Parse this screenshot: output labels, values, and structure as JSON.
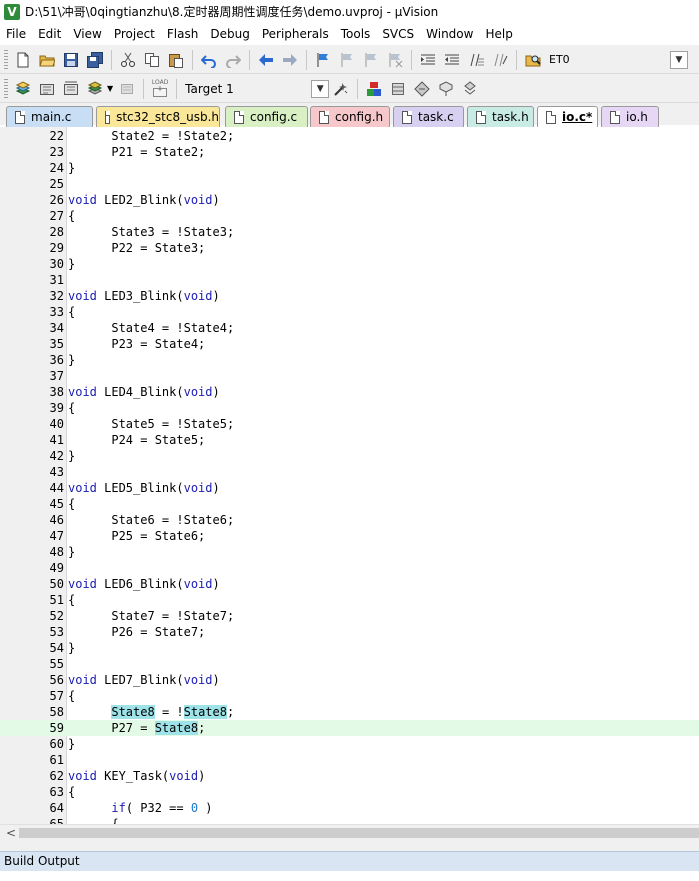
{
  "window": {
    "title": "D:\\51\\冲哥\\0qingtianzhu\\8.定时器周期性调度任务\\demo.uvproj - µVision",
    "logo_letter": "V"
  },
  "menu": [
    "File",
    "Edit",
    "View",
    "Project",
    "Flash",
    "Debug",
    "Peripherals",
    "Tools",
    "SVCS",
    "Window",
    "Help"
  ],
  "toolbar1": {
    "icons": [
      "new-file-icon",
      "open-folder-icon",
      "save-icon",
      "save-all-icon",
      "cut-icon",
      "copy-icon",
      "paste-icon",
      "undo-icon",
      "redo-icon",
      "back-icon",
      "forward-icon",
      "bookmark-icon",
      "bookmark-prev-icon",
      "bookmark-next-icon",
      "bookmark-clear-icon",
      "indent-icon",
      "unindent-icon",
      "comment-icon",
      "uncomment-icon",
      "find-in-files-icon"
    ],
    "find_value": "ET0"
  },
  "toolbar2": {
    "icons": [
      "translate-icon",
      "build-icon",
      "rebuild-icon",
      "batch-build-icon",
      "stop-build-icon",
      "download-icon"
    ],
    "load_label": "LOAD",
    "target_label": "Target 1",
    "right_icons": [
      "target-options-icon",
      "manage-components-icon",
      "select-packs-icon",
      "books-icon",
      "functions-icon",
      "templates-icon"
    ]
  },
  "tabs": [
    {
      "label": "main.c",
      "color": "#c8def4",
      "active": false
    },
    {
      "label": "stc32_stc8_usb.h",
      "color": "#fbe79a",
      "active": false
    },
    {
      "label": "config.c",
      "color": "#d8f0c4",
      "active": false
    },
    {
      "label": "config.h",
      "color": "#f6c8cc",
      "active": false
    },
    {
      "label": "task.c",
      "color": "#d8d0f0",
      "active": false
    },
    {
      "label": "task.h",
      "color": "#c8ece4",
      "active": false
    },
    {
      "label": "io.c*",
      "color": "#ffffff",
      "active": true
    },
    {
      "label": "io.h",
      "color": "#e6d8f4",
      "active": false
    }
  ],
  "code": [
    {
      "n": "22",
      "segs": [
        [
          "      State2 = !State2;",
          ""
        ]
      ]
    },
    {
      "n": "23",
      "segs": [
        [
          "      P21 = State2;",
          ""
        ]
      ]
    },
    {
      "n": "24",
      "segs": [
        [
          "}",
          ""
        ]
      ]
    },
    {
      "n": "25",
      "segs": []
    },
    {
      "n": "26",
      "segs": [
        [
          "void",
          "kw"
        ],
        [
          " LED2_Blink(",
          ""
        ],
        [
          "void",
          "kw"
        ],
        [
          ")",
          ""
        ]
      ]
    },
    {
      "n": "27",
      "segs": [
        [
          "{",
          ""
        ]
      ]
    },
    {
      "n": "28",
      "segs": [
        [
          "      State3 = !State3;",
          ""
        ]
      ]
    },
    {
      "n": "29",
      "segs": [
        [
          "      P22 = State3;",
          ""
        ]
      ]
    },
    {
      "n": "30",
      "segs": [
        [
          "}",
          ""
        ]
      ]
    },
    {
      "n": "31",
      "segs": []
    },
    {
      "n": "32",
      "segs": [
        [
          "void",
          "kw"
        ],
        [
          " LED3_Blink(",
          ""
        ],
        [
          "void",
          "kw"
        ],
        [
          ")",
          ""
        ]
      ]
    },
    {
      "n": "33",
      "segs": [
        [
          "{",
          ""
        ]
      ]
    },
    {
      "n": "34",
      "segs": [
        [
          "      State4 = !State4;",
          ""
        ]
      ]
    },
    {
      "n": "35",
      "segs": [
        [
          "      P23 = State4;",
          ""
        ]
      ]
    },
    {
      "n": "36",
      "segs": [
        [
          "}",
          ""
        ]
      ]
    },
    {
      "n": "37",
      "segs": []
    },
    {
      "n": "38",
      "segs": [
        [
          "void",
          "kw"
        ],
        [
          " LED4_Blink(",
          ""
        ],
        [
          "void",
          "kw"
        ],
        [
          ")",
          ""
        ]
      ]
    },
    {
      "n": "39",
      "segs": [
        [
          "{",
          ""
        ]
      ]
    },
    {
      "n": "40",
      "segs": [
        [
          "      State5 = !State5;",
          ""
        ]
      ]
    },
    {
      "n": "41",
      "segs": [
        [
          "      P24 = State5;",
          ""
        ]
      ]
    },
    {
      "n": "42",
      "segs": [
        [
          "}",
          ""
        ]
      ]
    },
    {
      "n": "43",
      "segs": []
    },
    {
      "n": "44",
      "segs": [
        [
          "void",
          "kw"
        ],
        [
          " LED5_Blink(",
          ""
        ],
        [
          "void",
          "kw"
        ],
        [
          ")",
          ""
        ]
      ]
    },
    {
      "n": "45",
      "segs": [
        [
          "{",
          ""
        ]
      ]
    },
    {
      "n": "46",
      "segs": [
        [
          "      State6 = !State6;",
          ""
        ]
      ]
    },
    {
      "n": "47",
      "segs": [
        [
          "      P25 = State6;",
          ""
        ]
      ]
    },
    {
      "n": "48",
      "segs": [
        [
          "}",
          ""
        ]
      ]
    },
    {
      "n": "49",
      "segs": []
    },
    {
      "n": "50",
      "segs": [
        [
          "void",
          "kw"
        ],
        [
          " LED6_Blink(",
          ""
        ],
        [
          "void",
          "kw"
        ],
        [
          ")",
          ""
        ]
      ]
    },
    {
      "n": "51",
      "segs": [
        [
          "{",
          ""
        ]
      ]
    },
    {
      "n": "52",
      "segs": [
        [
          "      State7 = !State7;",
          ""
        ]
      ]
    },
    {
      "n": "53",
      "segs": [
        [
          "      P26 = State7;",
          ""
        ]
      ]
    },
    {
      "n": "54",
      "segs": [
        [
          "}",
          ""
        ]
      ]
    },
    {
      "n": "55",
      "segs": []
    },
    {
      "n": "56",
      "segs": [
        [
          "void",
          "kw"
        ],
        [
          " LED7_Blink(",
          ""
        ],
        [
          "void",
          "kw"
        ],
        [
          ")",
          ""
        ]
      ]
    },
    {
      "n": "57",
      "segs": [
        [
          "{",
          ""
        ]
      ]
    },
    {
      "n": "58",
      "segs": [
        [
          "      ",
          ""
        ],
        [
          "State8",
          "hilite"
        ],
        [
          " = !",
          ""
        ],
        [
          "State8",
          "hilite"
        ],
        [
          ";",
          ""
        ]
      ]
    },
    {
      "n": "59",
      "hl": true,
      "segs": [
        [
          "      P27 = ",
          ""
        ],
        [
          "State8",
          "hilite"
        ],
        [
          ";",
          ""
        ]
      ]
    },
    {
      "n": "60",
      "segs": [
        [
          "}",
          ""
        ]
      ]
    },
    {
      "n": "61",
      "segs": []
    },
    {
      "n": "62",
      "segs": [
        [
          "void",
          "kw"
        ],
        [
          " KEY_Task(",
          ""
        ],
        [
          "void",
          "kw"
        ],
        [
          ")",
          ""
        ]
      ]
    },
    {
      "n": "63",
      "segs": [
        [
          "{",
          ""
        ]
      ]
    },
    {
      "n": "64",
      "segs": [
        [
          "      ",
          ""
        ],
        [
          "if",
          "kw"
        ],
        [
          "( P32 == ",
          ""
        ],
        [
          "0",
          "num"
        ],
        [
          " )",
          ""
        ]
      ]
    },
    {
      "n": "65",
      "segs": [
        [
          "      {",
          ""
        ]
      ]
    }
  ],
  "build_output": {
    "title": "Build Output"
  }
}
